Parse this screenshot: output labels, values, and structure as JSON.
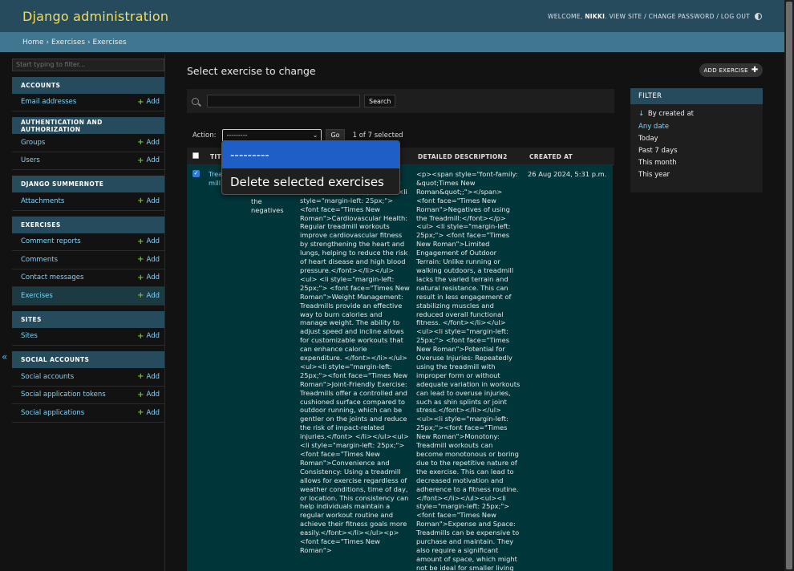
{
  "header": {
    "site_name": "Django administration",
    "welcome": "WELCOME,",
    "username": "NIKKI",
    "view_site": "VIEW SITE",
    "change_password": "CHANGE PASSWORD",
    "log_out": "LOG OUT",
    "sep": "/"
  },
  "breadcrumbs": {
    "home": "Home",
    "app": "Exercises",
    "model": "Exercises",
    "sep": "›"
  },
  "sidebar": {
    "filter_placeholder": "Start typing to filter...",
    "add_label": "Add",
    "collapse": "«",
    "modules": [
      {
        "caption": "ACCOUNTS",
        "models": [
          "Email addresses"
        ]
      },
      {
        "caption": "AUTHENTICATION AND AUTHORIZATION",
        "models": [
          "Groups",
          "Users"
        ]
      },
      {
        "caption": "DJANGO SUMMERNOTE",
        "models": [
          "Attachments"
        ]
      },
      {
        "caption": "EXERCISES",
        "models": [
          "Comment reports",
          "Comments",
          "Contact messages",
          "Exercises"
        ]
      },
      {
        "caption": "SITES",
        "models": [
          "Sites"
        ]
      },
      {
        "caption": "SOCIAL ACCOUNTS",
        "models": [
          "Social accounts",
          "Social application tokens",
          "Social applications"
        ]
      }
    ],
    "current": "Exercises"
  },
  "main": {
    "title": "Select exercise to change",
    "add_button": "ADD EXERCISE",
    "search_button": "Search",
    "action_label": "Action:",
    "action_value": "---------",
    "go_button": "Go",
    "selected_count": "1 of 7 selected",
    "action_options": [
      "---------",
      "Delete selected exercises"
    ],
    "columns": [
      "TITL",
      "DETAILED DESCRIPTION2",
      "CREATED AT"
    ],
    "row": {
      "title": "Treadmill Cardio",
      "description": "treadmill vs the negatives",
      "detail1": "face=\"Times New Roman\">Benefits of using the Treadmill:</font></p> <ul> <li style=\"margin-left: 25px;\"><font face=\"Times New Roman\">Cardiovascular Health: Regular treadmill workouts improve cardiovascular fitness by strengthening the heart and lungs, helping to reduce the risk of heart disease and high blood pressure.</font></li></ul><ul> <li style=\"margin-left: 25px;\"> <font face=\"Times New Roman\">Weight Management: Treadmills provide an effective way to burn calories and manage weight. The ability to adjust speed and incline allows for customizable workouts that can enhance calorie expenditure. </font></li></ul><ul><li style=\"margin-left: 25px;\"><font face=\"Times New Roman\">Joint-Friendly Exercise: Treadmills offer a controlled and cushioned surface compared to outdoor running, which can be gentler on the joints and reduce the risk of impact-related injuries.</font> </li></ul><ul><li style=\"margin-left: 25px;\"><font face=\"Times New Roman\">Convenience and Consistency: Using a treadmill allows for exercise regardless of weather conditions, time of day, or location. This consistency can help individuals maintain a regular workout routine and achieve their fitness goals more easily.</font></li></ul><p> <font face=\"Times New Roman\">",
      "detail2": "<p><span style=\"font-family: &quot;Times New Roman&quot;;\"></span><font face=\"Times New Roman\">Negatives of using the Treadmill:</font></p> <ul> <li style=\"margin-left: 25px;\"> <font face=\"Times New Roman\">Limited Engagement of Outdoor Terrain: Unlike running or walking outdoors, a treadmill lacks the varied terrain and natural resistance. This can result in less engagement of stabilizing muscles and reduced overall functional fitness. </font></li></ul><ul><li style=\"margin-left: 25px;\"> <font face=\"Times New Roman\">Potential for Overuse Injuries: Repeatedly using the treadmill with improper form or without adequate variation in workouts can lead to overuse injuries, such as shin splints or joint stress.</font></li></ul> <ul><li style=\"margin-left: 25px;\"><font face=\"Times New Roman\">Monotony: Treadmill workouts can become monotonous or boring due to the repetitive nature of the exercise. This can lead to decreased motivation and adherence to a fitness routine. </font></li></ul><ul><li style=\"margin-left: 25px;\"> <font face=\"Times New Roman\">Expense and Space: Treadmills can be expensive to purchase and maintain. They also require a significant amount of space, which might not be ideal for smaller living areas or budgets.</font></li>",
      "created_at": "26 Aug 2024, 5:31 p.m."
    }
  },
  "filter": {
    "title": "FILTER",
    "heading": "By created at",
    "options": [
      "Any date",
      "Today",
      "Past 7 days",
      "This month",
      "This year"
    ],
    "selected": "Any date"
  }
}
